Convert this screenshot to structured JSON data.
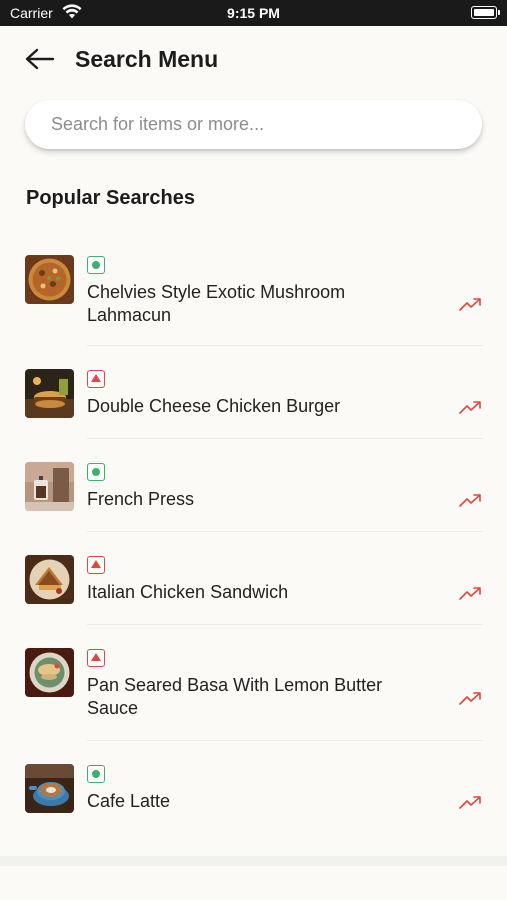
{
  "status_bar": {
    "carrier": "Carrier",
    "time": "9:15 PM",
    "battery_level": 1.0
  },
  "header": {
    "title": "Search Menu",
    "back_icon": "arrow-left-icon"
  },
  "search": {
    "placeholder": "Search for items or more...",
    "value": ""
  },
  "popular": {
    "title": "Popular Searches",
    "items": [
      {
        "name": "Chelvies Style Exotic Mushroom Lahmacun",
        "diet": "veg",
        "image": "pizza",
        "trend_icon": "trending-up-icon"
      },
      {
        "name": "Double Cheese Chicken Burger",
        "diet": "non-veg",
        "image": "burger",
        "trend_icon": "trending-up-icon"
      },
      {
        "name": "French Press",
        "diet": "veg",
        "image": "coffee-press",
        "trend_icon": "trending-up-icon"
      },
      {
        "name": "Italian Chicken Sandwich",
        "diet": "non-veg",
        "image": "sandwich",
        "trend_icon": "trending-up-icon"
      },
      {
        "name": "Pan Seared Basa With Lemon Butter Sauce",
        "diet": "non-veg",
        "image": "fish-plate",
        "trend_icon": "trending-up-icon"
      },
      {
        "name": "Cafe Latte",
        "diet": "veg",
        "image": "latte",
        "trend_icon": "trending-up-icon"
      }
    ]
  },
  "colors": {
    "background": "#fbfaf6",
    "veg": "#3ab26e",
    "non_veg": "#e0473f",
    "trend": "#e0473f"
  }
}
